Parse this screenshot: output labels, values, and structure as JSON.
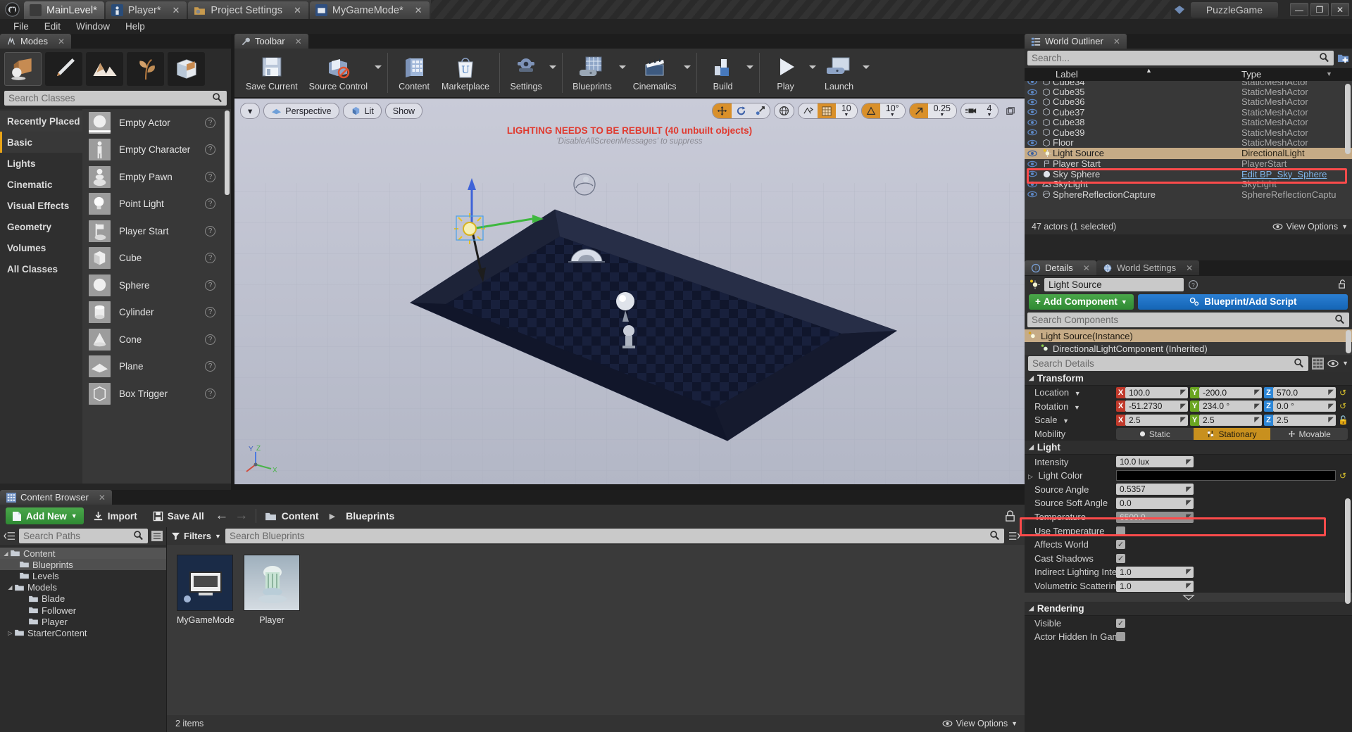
{
  "window": {
    "project_name": "PuzzleGame",
    "minimize": "—",
    "maximize": "❐",
    "close": "✕",
    "tabs": [
      {
        "label": "MainLevel*",
        "active": true,
        "icon": "level-icon",
        "closable": false
      },
      {
        "label": "Player*",
        "active": false,
        "icon": "blueprint-icon",
        "closable": true
      },
      {
        "label": "Project Settings",
        "active": false,
        "icon": "settings-icon",
        "closable": true
      },
      {
        "label": "MyGameMode*",
        "active": false,
        "icon": "gamemode-icon",
        "closable": true
      }
    ]
  },
  "menu": [
    "File",
    "Edit",
    "Window",
    "Help"
  ],
  "modes": {
    "tab_title": "Modes",
    "mode_buttons": [
      "place-mode",
      "paint-mode",
      "landscape-mode",
      "foliage-mode",
      "geometry-edit-mode"
    ],
    "search_placeholder": "Search Classes",
    "categories": [
      {
        "label": "Recently Placed",
        "selected": false
      },
      {
        "label": "Basic",
        "selected": true
      },
      {
        "label": "Lights",
        "selected": false
      },
      {
        "label": "Cinematic",
        "selected": false
      },
      {
        "label": "Visual Effects",
        "selected": false
      },
      {
        "label": "Geometry",
        "selected": false
      },
      {
        "label": "Volumes",
        "selected": false
      },
      {
        "label": "All Classes",
        "selected": false
      }
    ],
    "placeables": [
      {
        "label": "Empty Actor"
      },
      {
        "label": "Empty Character"
      },
      {
        "label": "Empty Pawn"
      },
      {
        "label": "Point Light"
      },
      {
        "label": "Player Start"
      },
      {
        "label": "Cube"
      },
      {
        "label": "Sphere"
      },
      {
        "label": "Cylinder"
      },
      {
        "label": "Cone"
      },
      {
        "label": "Plane"
      },
      {
        "label": "Box Trigger"
      }
    ]
  },
  "toolbar": {
    "tab_title": "Toolbar",
    "items": [
      {
        "label": "Save Current",
        "icon": "save-icon",
        "caret": false
      },
      {
        "label": "Source Control",
        "icon": "source-control-icon",
        "caret": true
      },
      {
        "label": "Content",
        "icon": "content-icon",
        "caret": false
      },
      {
        "label": "Marketplace",
        "icon": "marketplace-icon",
        "caret": false
      },
      {
        "label": "Settings",
        "icon": "settings-gear-icon",
        "caret": true
      },
      {
        "label": "Blueprints",
        "icon": "blueprints-icon",
        "caret": true
      },
      {
        "label": "Cinematics",
        "icon": "cinematics-icon",
        "caret": true
      },
      {
        "label": "Build",
        "icon": "build-icon",
        "caret": true
      },
      {
        "label": "Play",
        "icon": "play-icon",
        "caret": true
      },
      {
        "label": "Launch",
        "icon": "launch-icon",
        "caret": true
      }
    ]
  },
  "viewport": {
    "view_menu": "▾",
    "perspective": "Perspective",
    "lit": "Lit",
    "show": "Show",
    "warning_line1": "LIGHTING NEEDS TO BE REBUILT (40 unbuilt objects)",
    "warning_line2": "'DisableAllScreenMessages' to suppress",
    "grid_snap_value": "10",
    "rotation_snap_value": "10°",
    "scale_snap_value": "0.25",
    "camera_speed_value": "4",
    "axis_labels": [
      "Y",
      "Z",
      "X"
    ]
  },
  "outliner": {
    "tab_title": "World Outliner",
    "search_placeholder": "Search...",
    "col_label": "Label",
    "col_type": "Type",
    "rows": [
      {
        "label": "Cube34",
        "type": "StaticMeshActor",
        "icon": "static-mesh-icon",
        "selected": false,
        "partial": true
      },
      {
        "label": "Cube35",
        "type": "StaticMeshActor",
        "icon": "static-mesh-icon",
        "selected": false
      },
      {
        "label": "Cube36",
        "type": "StaticMeshActor",
        "icon": "static-mesh-icon",
        "selected": false
      },
      {
        "label": "Cube37",
        "type": "StaticMeshActor",
        "icon": "static-mesh-icon",
        "selected": false
      },
      {
        "label": "Cube38",
        "type": "StaticMeshActor",
        "icon": "static-mesh-icon",
        "selected": false
      },
      {
        "label": "Cube39",
        "type": "StaticMeshActor",
        "icon": "static-mesh-icon",
        "selected": false
      },
      {
        "label": "Floor",
        "type": "StaticMeshActor",
        "icon": "static-mesh-icon",
        "selected": false
      },
      {
        "label": "Light Source",
        "type": "DirectionalLight",
        "icon": "light-icon",
        "selected": true
      },
      {
        "label": "Player Start",
        "type": "PlayerStart",
        "icon": "player-start-icon",
        "selected": false
      },
      {
        "label": "Sky Sphere",
        "type": "Edit BP_Sky_Sphere",
        "icon": "sphere-icon",
        "selected": false,
        "link": true
      },
      {
        "label": "SkyLight",
        "type": "SkyLight",
        "icon": "skylight-icon",
        "selected": false
      },
      {
        "label": "SphereReflectionCapture",
        "type": "SphereReflectionCaptu",
        "icon": "reflection-icon",
        "selected": false
      }
    ],
    "footer_status": "47 actors (1 selected)",
    "view_options": "View Options"
  },
  "details": {
    "tabs": [
      {
        "label": "Details",
        "active": true,
        "icon": "info-icon"
      },
      {
        "label": "World Settings",
        "active": false,
        "icon": "globe-icon"
      }
    ],
    "actor_name": "Light Source",
    "add_component": "Add Component",
    "blueprint_script": "Blueprint/Add Script",
    "components_placeholder": "Search Components",
    "components": [
      {
        "label": "Light Source(Instance)",
        "selected": true,
        "indent": 0
      },
      {
        "label": "DirectionalLightComponent (Inherited)",
        "selected": false,
        "indent": 1
      }
    ],
    "details_placeholder": "Search Details",
    "sections": {
      "transform": {
        "title": "Transform",
        "location": {
          "label": "Location",
          "x": "100.0",
          "y": "-200.0",
          "z": "570.0"
        },
        "rotation": {
          "label": "Rotation",
          "x": "-51.2730",
          "y": "234.0 °",
          "z": "0.0 °"
        },
        "scale": {
          "label": "Scale",
          "x": "2.5",
          "y": "2.5",
          "z": "2.5"
        },
        "mobility": {
          "label": "Mobility",
          "options": [
            "Static",
            "Stationary",
            "Movable"
          ],
          "selected": "Stationary"
        }
      },
      "light": {
        "title": "Light",
        "rows": [
          {
            "label": "Intensity",
            "type": "num",
            "value": "10.0 lux"
          },
          {
            "label": "Light Color",
            "type": "color",
            "value": "#000000",
            "expandable": true
          },
          {
            "label": "Source Angle",
            "type": "num",
            "value": "0.5357"
          },
          {
            "label": "Source Soft Angle",
            "type": "num",
            "value": "0.0"
          },
          {
            "label": "Temperature",
            "type": "num-dim",
            "value": "6500.0"
          },
          {
            "label": "Use Temperature",
            "type": "check",
            "value": false
          },
          {
            "label": "Affects World",
            "type": "check",
            "value": true
          },
          {
            "label": "Cast Shadows",
            "type": "check",
            "value": true
          },
          {
            "label": "Indirect Lighting Intensity",
            "type": "num",
            "value": "1.0"
          },
          {
            "label": "Volumetric Scattering Inten:",
            "type": "num",
            "value": "1.0"
          }
        ]
      },
      "rendering": {
        "title": "Rendering",
        "rows": [
          {
            "label": "Visible",
            "type": "check",
            "value": true
          },
          {
            "label": "Actor Hidden In Game",
            "type": "check",
            "value": false
          }
        ]
      }
    }
  },
  "content_browser": {
    "tab_title": "Content Browser",
    "add_new": "Add New",
    "import": "Import",
    "save_all": "Save All",
    "breadcrumb": [
      "Content",
      "Blueprints"
    ],
    "paths_placeholder": "Search Paths",
    "assets_placeholder": "Search Blueprints",
    "filters": "Filters",
    "tree": [
      {
        "label": "Content",
        "depth": 0,
        "expander": "open",
        "selected": false
      },
      {
        "label": "Blueprints",
        "depth": 1,
        "expander": "none",
        "selected": true
      },
      {
        "label": "Levels",
        "depth": 1,
        "expander": "none",
        "selected": false
      },
      {
        "label": "Models",
        "depth": 1,
        "expander": "open",
        "selected": false
      },
      {
        "label": "Blade",
        "depth": 2,
        "expander": "none",
        "selected": false
      },
      {
        "label": "Follower",
        "depth": 2,
        "expander": "none",
        "selected": false
      },
      {
        "label": "Player",
        "depth": 2,
        "expander": "none",
        "selected": false
      },
      {
        "label": "StarterContent",
        "depth": 0.5,
        "expander": "closed",
        "selected": false
      }
    ],
    "assets": [
      {
        "name": "MyGameMode",
        "kind": "gamemode"
      },
      {
        "name": "Player",
        "kind": "pawn"
      }
    ],
    "item_count": "2 items",
    "view_options": "View Options"
  },
  "highlights": {
    "outliner_light_source": "red-highlight-outliner-row",
    "details_light_color": "red-highlight-light-color"
  }
}
